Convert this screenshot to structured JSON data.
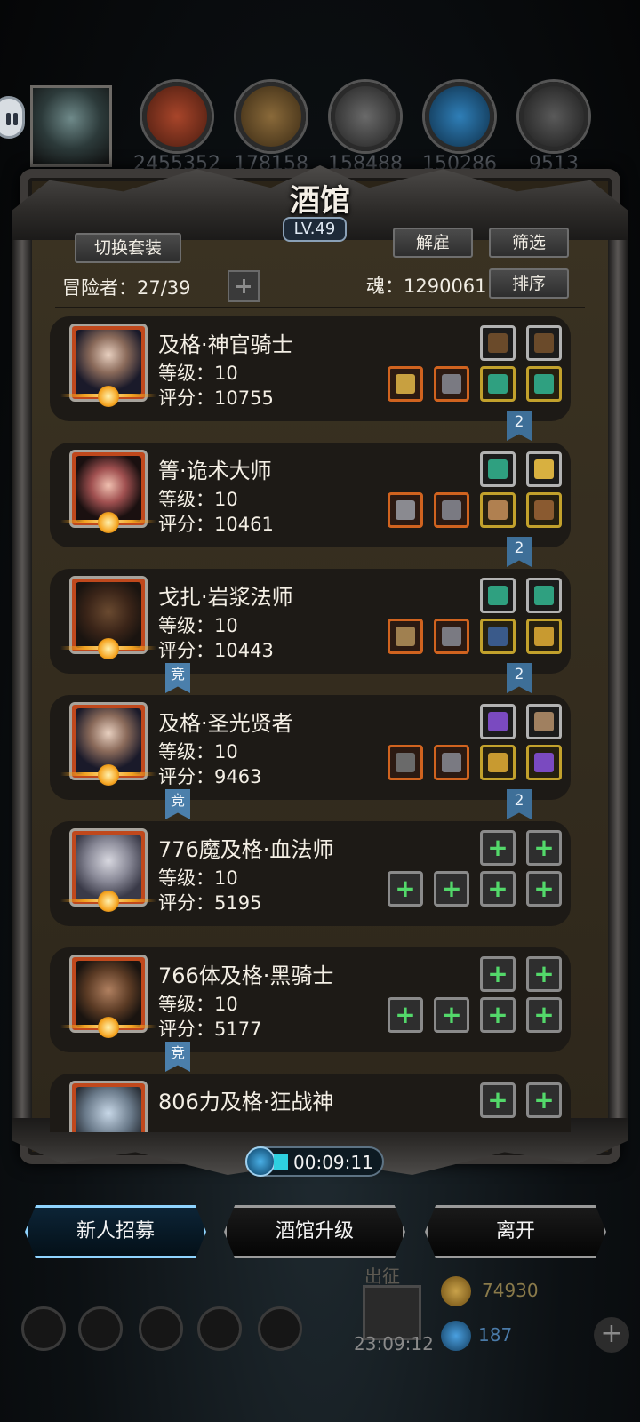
{
  "top_resources": [
    "2455352",
    "178158",
    "158488",
    "150286",
    "9513"
  ],
  "top_resource_icons": [
    "meat-icon",
    "wood-icon",
    "stone-icon",
    "crystal-icon",
    "iron-icon"
  ],
  "panel": {
    "title": "酒馆",
    "level": "LV.49",
    "switch_outfit_label": "切换套装",
    "dismiss_label": "解雇",
    "filter_label": "筛选",
    "sort_label": "排序",
    "adventurers_label": "冒险者：27/39",
    "soul_label": "魂：1290061"
  },
  "heroes": [
    {
      "name": "及格·神官骑士",
      "level": "等级：10",
      "score": "评分：10755",
      "badge": "2",
      "jing": false,
      "top_slots": [
        "bow-icon",
        "bow-icon"
      ],
      "bottom_slots": [
        "hammer-icon",
        "armor-icon",
        "gem-icon",
        "gem-icon"
      ]
    },
    {
      "name": "箐·诡术大师",
      "level": "等级：10",
      "score": "评分：10461",
      "badge": "2",
      "jing": false,
      "top_slots": [
        "gem-icon",
        "lantern-icon"
      ],
      "bottom_slots": [
        "sword-icon",
        "armor-icon",
        "shield-icon",
        "boots-icon"
      ]
    },
    {
      "name": "戈扎·岩浆法师",
      "level": "等级：10",
      "score": "评分：10443",
      "badge": "2",
      "jing": true,
      "top_slots": [
        "gem-icon",
        "gem-icon"
      ],
      "bottom_slots": [
        "staff-icon",
        "armor-icon",
        "scroll-icon",
        "ring-icon"
      ]
    },
    {
      "name": "及格·圣光贤者",
      "level": "等级：10",
      "score": "评分：9463",
      "badge": "2",
      "jing": true,
      "top_slots": [
        "wand-icon",
        "orb-icon"
      ],
      "bottom_slots": [
        "mace-icon",
        "armor-icon",
        "ring-icon",
        "wand-icon"
      ]
    },
    {
      "name": "776魔及格·血法师",
      "level": "等级：10",
      "score": "评分：5195",
      "badge": "",
      "jing": false,
      "top_slots": [
        "empty",
        "empty"
      ],
      "bottom_slots": [
        "empty",
        "empty",
        "empty",
        "empty"
      ]
    },
    {
      "name": "766体及格·黑骑士",
      "level": "等级：10",
      "score": "评分：5177",
      "badge": "",
      "jing": true,
      "top_slots": [
        "empty",
        "empty"
      ],
      "bottom_slots": [
        "empty",
        "empty",
        "empty",
        "empty"
      ]
    },
    {
      "name": "806力及格·狂战神",
      "level": "",
      "score": "",
      "badge": "",
      "jing": false,
      "top_slots": [
        "empty",
        "empty"
      ],
      "bottom_slots": []
    }
  ],
  "jing_label": "竞",
  "timer": "00:09:11",
  "actions": {
    "recruit": "新人招募",
    "upgrade": "酒馆升级",
    "leave": "离开"
  },
  "hud": {
    "expedition": "出征",
    "gift_timer": "23:09:12",
    "gold": "74930",
    "gems": "187"
  },
  "colors": {
    "accent_blue": "#8fd4ff",
    "slot_orange": "#d0631f",
    "slot_gold": "#c2a12c",
    "plus_green": "#53d86a"
  }
}
